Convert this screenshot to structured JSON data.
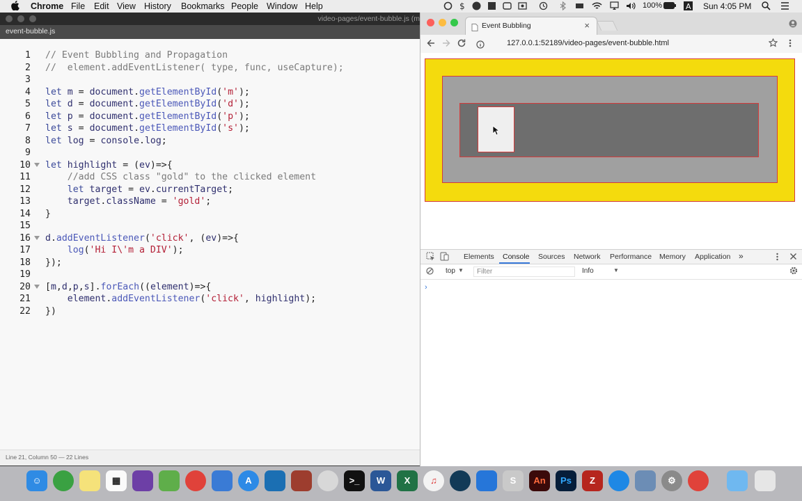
{
  "menubar": {
    "app": "Chrome",
    "items": [
      "File",
      "Edit",
      "View",
      "History",
      "Bookmarks",
      "People",
      "Window",
      "Help"
    ],
    "battery": "100%",
    "clock": "Sun 4:05 PM"
  },
  "editor": {
    "path": "video-pages/event-bubble.js (m",
    "filename": "event-bubble.js",
    "status": "Line 21, Column 50 — 22 Lines",
    "lines": [
      "// Event Bubbling and Propagation",
      "//  element.addEventListener( type, func, useCapture);",
      "",
      "let m = document.getElementById('m');",
      "let d = document.getElementById('d');",
      "let p = document.getElementById('p');",
      "let s = document.getElementById('s');",
      "let log = console.log;",
      "",
      "let highlight = (ev)=>{",
      "    //add CSS class \"gold\" to the clicked element",
      "    let target = ev.currentTarget;",
      "    target.className = 'gold';",
      "}",
      "",
      "d.addEventListener('click', (ev)=>{",
      "    log('Hi I\\'m a DIV');",
      "});",
      "",
      "[m,d,p,s].forEach((element)=>{",
      "    element.addEventListener('click', highlight);",
      "})"
    ]
  },
  "browser": {
    "tab_title": "Event Bubbling",
    "tab_close": "×",
    "url": "127.0.0.1:52189/video-pages/event-bubble.html"
  },
  "devtools": {
    "tabs": [
      "Elements",
      "Console",
      "Sources",
      "Network",
      "Performance",
      "Memory",
      "Application"
    ],
    "more": "»",
    "context": "top",
    "filter_placeholder": "Filter",
    "level": "Info",
    "prompt": "›"
  },
  "colors": {
    "outer_box": "#f4db0d",
    "box_border": "#d43b3b",
    "middle_box": "#a0a0a0",
    "inner_box": "#6e6e6e",
    "span_box": "#efefef"
  }
}
